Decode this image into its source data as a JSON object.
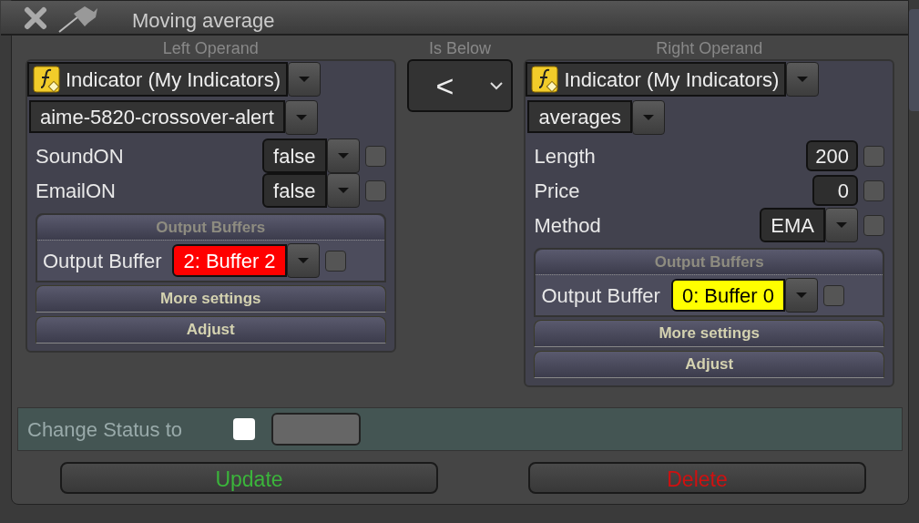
{
  "window": {
    "title": "Moving average"
  },
  "left_operand": {
    "heading": "Left Operand",
    "source": "Indicator (My Indicators)",
    "indicator": "aime-5820-crossover-alert",
    "params": [
      {
        "label": "SoundON",
        "kind": "dropdown",
        "value": "false",
        "checked": false
      },
      {
        "label": "EmailON",
        "kind": "dropdown",
        "value": "false",
        "checked": false
      }
    ],
    "output_buffers": {
      "heading": "Output Buffers",
      "rows": [
        {
          "label": "Output Buffer",
          "value": "2: Buffer 2",
          "color": "#ff0000",
          "checked": false
        }
      ]
    },
    "buttons": [
      "More settings",
      "Adjust"
    ]
  },
  "comparator": {
    "heading": "Is Below",
    "value": "<"
  },
  "right_operand": {
    "heading": "Right Operand",
    "source": "Indicator (My Indicators)",
    "indicator": "averages",
    "params": [
      {
        "label": "Length",
        "kind": "number",
        "value": "200",
        "checked": false
      },
      {
        "label": "Price",
        "kind": "number",
        "value": "0",
        "checked": false
      },
      {
        "label": "Method",
        "kind": "dropdown",
        "value": "EMA",
        "checked": false
      }
    ],
    "output_buffers": {
      "heading": "Output Buffers",
      "rows": [
        {
          "label": "Output Buffer",
          "value": "0: Buffer 0",
          "color": "#ffff00",
          "checked": false
        }
      ]
    },
    "buttons": [
      "More settings",
      "Adjust"
    ]
  },
  "status": {
    "label": "Change Status to",
    "checked": false
  },
  "actions": [
    {
      "label": "Update",
      "kind": "update"
    },
    {
      "label": "Delete",
      "kind": "delete"
    }
  ]
}
